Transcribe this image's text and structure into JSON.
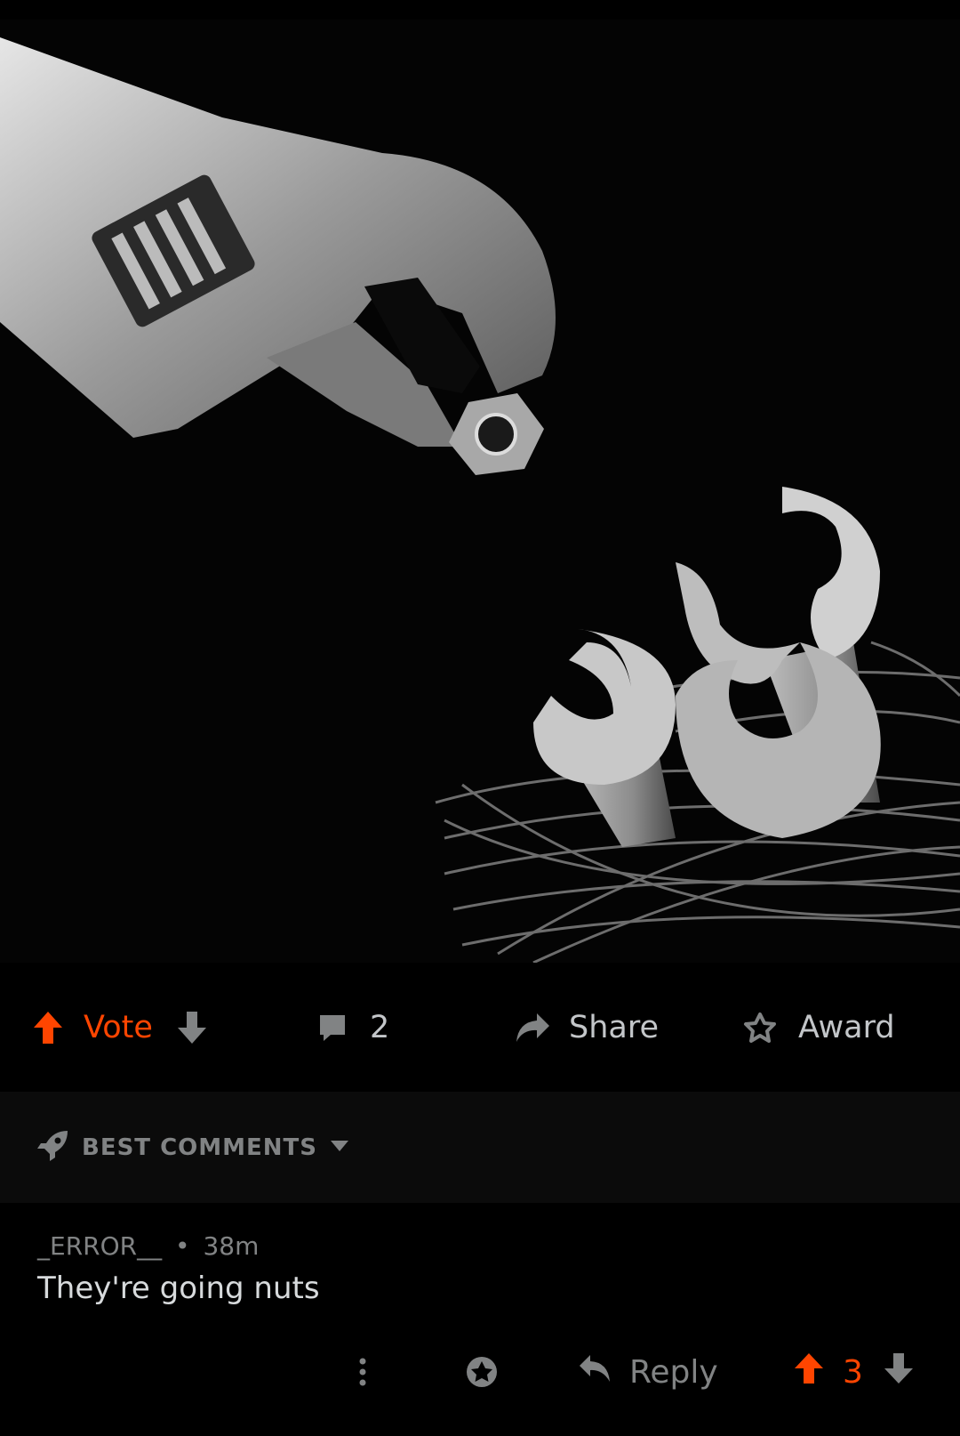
{
  "post": {
    "image": {
      "alt_icon": "photo-wrench-feeding-nest"
    },
    "actions": {
      "vote_label": "Vote",
      "comment_count": "2",
      "share_label": "Share",
      "award_label": "Award"
    }
  },
  "comments_header": {
    "sort_label": "BEST COMMENTS"
  },
  "comment": {
    "author": "_ERROR__",
    "separator": "•",
    "age": "38m",
    "text": "They're going nuts",
    "reply_label": "Reply",
    "score": "3"
  },
  "colors": {
    "accent": "#ff4500",
    "muted": "#818384",
    "text": "#d7dadc",
    "background": "#000000",
    "sort_background": "#0b0b0b"
  }
}
